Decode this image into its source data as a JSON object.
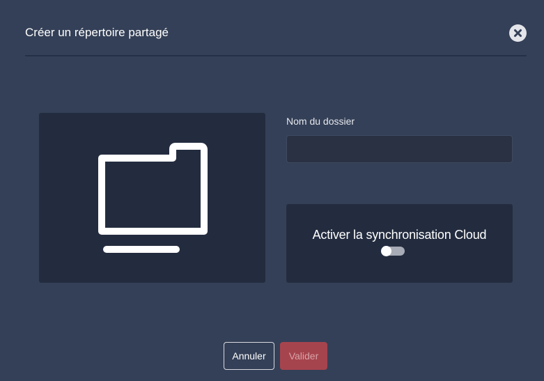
{
  "dialog": {
    "title": "Créer un répertoire partagé",
    "close_icon": "close-icon",
    "preview_icon": "folder-icon"
  },
  "form": {
    "folder_name_label": "Nom du dossier",
    "folder_name_value": "",
    "folder_name_placeholder": "",
    "sync_label": "Activer la synchronisation Cloud",
    "sync_enabled": false
  },
  "actions": {
    "cancel_label": "Annuler",
    "validate_label": "Valider",
    "validate_enabled": false
  },
  "colors": {
    "background": "#344057",
    "panel": "#232c3f",
    "accent_button": "#a6444d"
  }
}
